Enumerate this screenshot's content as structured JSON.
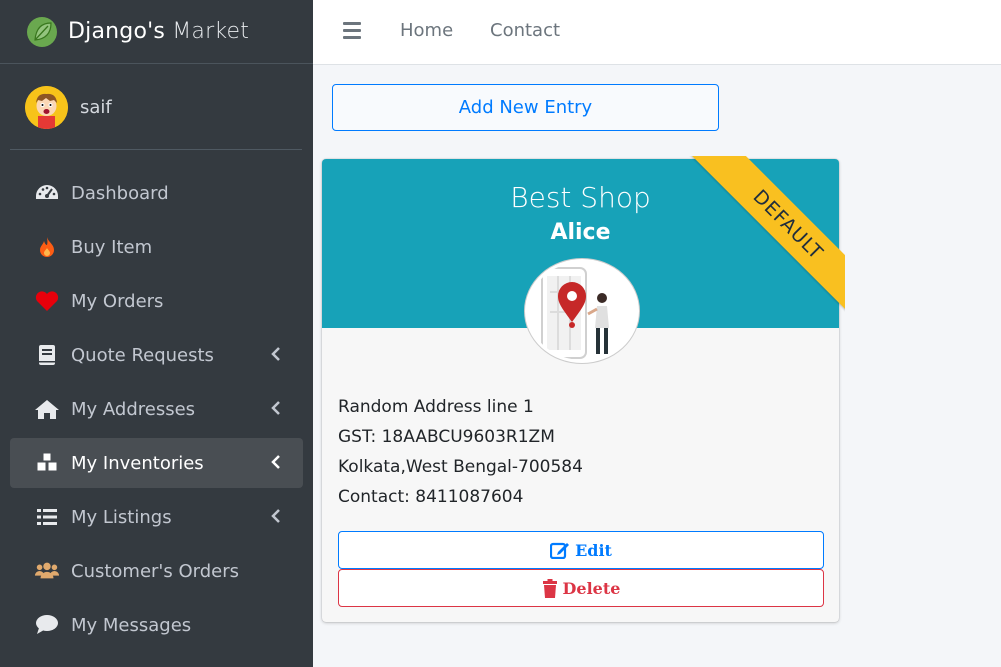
{
  "brand": {
    "name_strong": "Django's",
    "name_light": "Market"
  },
  "user": {
    "name": "saif"
  },
  "nav": [
    {
      "label": "Dashboard",
      "icon": "tachometer-icon",
      "has_children": false,
      "active": false
    },
    {
      "label": "Buy Item",
      "icon": "fire-icon",
      "has_children": false,
      "active": false
    },
    {
      "label": "My Orders",
      "icon": "heart-icon",
      "has_children": false,
      "active": false
    },
    {
      "label": "Quote Requests",
      "icon": "book-icon",
      "has_children": true,
      "active": false
    },
    {
      "label": "My Addresses",
      "icon": "home-icon",
      "has_children": true,
      "active": false
    },
    {
      "label": "My Inventories",
      "icon": "cubes-icon",
      "has_children": true,
      "active": true
    },
    {
      "label": "My Listings",
      "icon": "list-icon",
      "has_children": true,
      "active": false
    },
    {
      "label": "Customer's Orders",
      "icon": "users-icon",
      "has_children": false,
      "active": false
    },
    {
      "label": "My Messages",
      "icon": "comment-icon",
      "has_children": false,
      "active": false
    }
  ],
  "topbar": {
    "home": "Home",
    "contact": "Contact"
  },
  "add_button": "Add New Entry",
  "card": {
    "shop_name": "Best Shop",
    "owner": "Alice",
    "ribbon": "DEFAULT",
    "address_line": "Random Address line 1",
    "gst": "GST: 18AABCU9603R1ZM",
    "city_state": "Kolkata,West Bengal-700584",
    "contact": "Contact: 8411087604",
    "edit_label": "Edit",
    "delete_label": "Delete"
  },
  "colors": {
    "sidebar": "#343a40",
    "accent": "#17a2b8",
    "primary": "#007bff",
    "danger": "#dc3545",
    "ribbon": "#f9c020"
  }
}
